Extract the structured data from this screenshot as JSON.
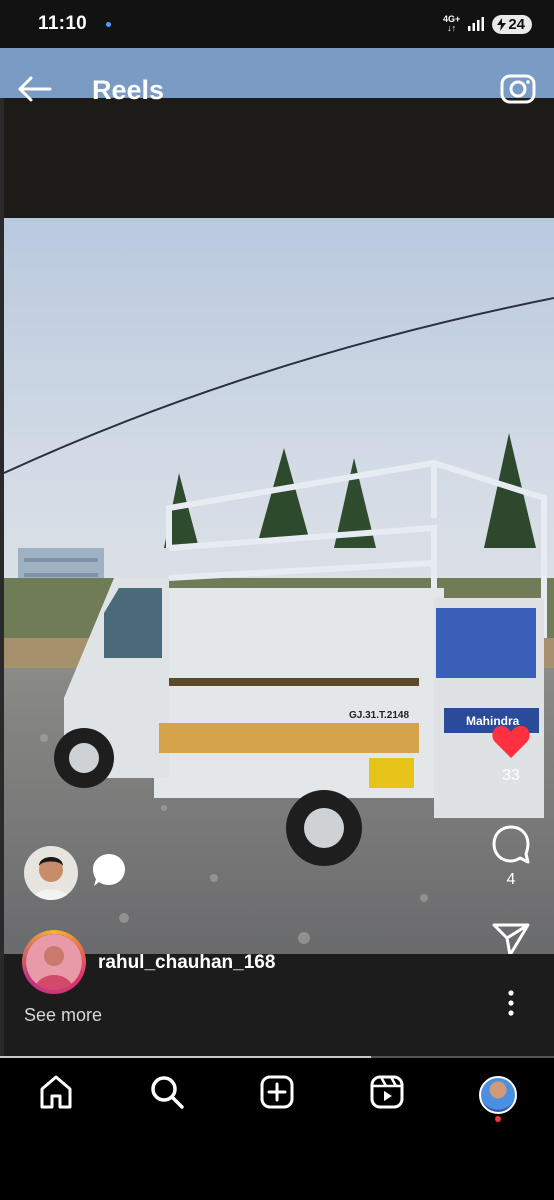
{
  "status_bar": {
    "time": "11:10",
    "network": "4G+",
    "battery": "24"
  },
  "header": {
    "title": "Reels"
  },
  "actions": {
    "likes": "33",
    "comments": "4"
  },
  "post": {
    "username": "rahul_chauhan_168",
    "see_more": "See more"
  },
  "playback": {
    "progress_percent": 67
  },
  "nav": {
    "items": [
      "home-icon",
      "search-icon",
      "create-icon",
      "reels-icon",
      "profile-avatar"
    ]
  },
  "colors": {
    "like": "#ff3040",
    "background": "#000000"
  },
  "vehicle": {
    "brand": "Mahindra",
    "plate": "GJ.31.T.2148"
  }
}
